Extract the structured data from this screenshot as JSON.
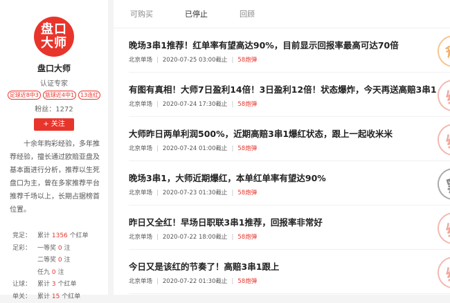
{
  "profile": {
    "logo_line1": "盘口",
    "logo_line2": "大师",
    "name": "盘口大师",
    "cert": "认证专家",
    "tags": [
      "足球近8中3",
      "篮球近4中1",
      "13连红"
    ],
    "fans": "粉丝：1272",
    "follow": "+ 关注",
    "bio": "十余年购彩经验，多年推荐经验，擅长通过欧赔亚盘及基本面进行分析，推荐以生死盘口为主，曾在多家推荐平台推荐千场以上，长期占据榜首位置。"
  },
  "stats": [
    {
      "label": "竞足：",
      "text": "累计",
      "num": "1356",
      "suffix": "个红单"
    },
    {
      "label": "足彩：",
      "text": "一等奖",
      "num": "0",
      "suffix": "注"
    },
    {
      "label": "",
      "text": "二等奖",
      "num": "0",
      "suffix": "注"
    },
    {
      "label": "",
      "text": "任九",
      "num": "0",
      "suffix": "注"
    },
    {
      "label": "让球：",
      "text": "累计",
      "num": "3",
      "suffix": "个红单"
    },
    {
      "label": "单关：",
      "text": "累计",
      "num": "15",
      "suffix": "个红单"
    }
  ],
  "tabs": [
    "可购买",
    "已停止",
    "回顾"
  ],
  "active_tab": 1,
  "items": [
    {
      "title": "晚场3串1推荐！红单率有望高达90%，目前显示回报率最高可达70倍",
      "category": "北京单场",
      "time": "2020-07-25 03:00截止",
      "fire": "58炮弹",
      "stamp": "稳",
      "stamp_color": "orange"
    },
    {
      "title": "有图有真相！大师7日盈利14倍！3日盈利12倍！状态爆炸，今天再送高赔3串1",
      "category": "北京单场",
      "time": "2020-07-24 17:30截止",
      "fire": "58炮弹",
      "stamp": "红",
      "stamp_color": "red"
    },
    {
      "title": "大师昨日两单利润500%，近期高赔3串1爆红状态，跟上一起收米米",
      "category": "北京单场",
      "time": "2020-07-24 01:00截止",
      "fire": "58炮弹",
      "stamp": "红",
      "stamp_color": "red"
    },
    {
      "title": "晚场3串1，大师近期爆红，本单红单率有望达90%",
      "category": "北京单场",
      "time": "2020-07-23 01:30截止",
      "fire": "58炮弹",
      "stamp": "黑",
      "stamp_color": "gray"
    },
    {
      "title": "昨日又全红！早场日职联3串1推荐，回报率非常好",
      "category": "北京单场",
      "time": "2020-07-22 18:00截止",
      "fire": "58炮弹",
      "stamp": "红",
      "stamp_color": "red"
    },
    {
      "title": "今日又是该红的节奏了！高赔3串1跟上",
      "category": "北京单场",
      "time": "2020-07-22 01:30截止",
      "fire": "58炮弹",
      "stamp": "红",
      "stamp_color": "red"
    }
  ]
}
